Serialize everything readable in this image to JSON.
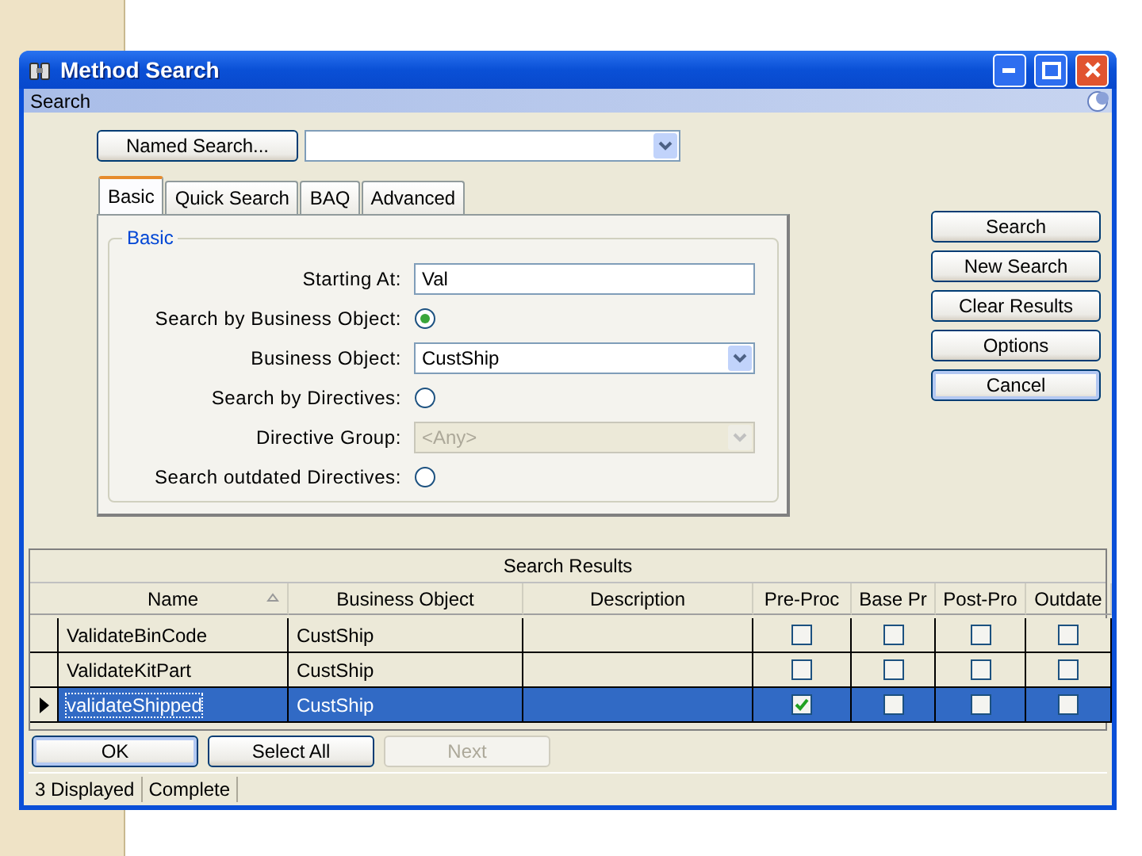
{
  "window": {
    "title": "Method Search",
    "subtitle": "Search"
  },
  "named_search": {
    "button": "Named Search..."
  },
  "tabs": [
    {
      "label": "Basic",
      "selected": true
    },
    {
      "label": "Quick Search",
      "selected": false
    },
    {
      "label": "BAQ",
      "selected": false
    },
    {
      "label": "Advanced",
      "selected": false
    }
  ],
  "group": {
    "title": "Basic",
    "fields": [
      {
        "kind": "text",
        "label": "Starting At:",
        "value": "Val",
        "disabled": false
      },
      {
        "kind": "radio",
        "label": "Search by Business Object:",
        "checked": true
      },
      {
        "kind": "select",
        "label": "Business Object:",
        "value": "CustShip",
        "disabled": false
      },
      {
        "kind": "radio",
        "label": "Search by Directives:",
        "checked": false
      },
      {
        "kind": "select",
        "label": "Directive Group:",
        "value": "<Any>",
        "disabled": true
      },
      {
        "kind": "radio",
        "label": "Search outdated Directives:",
        "checked": false
      }
    ]
  },
  "side_buttons": [
    {
      "label": "Search",
      "focused": false
    },
    {
      "label": "New Search",
      "focused": false
    },
    {
      "label": "Clear Results",
      "focused": false
    },
    {
      "label": "Options",
      "focused": false
    },
    {
      "label": "Cancel",
      "focused": true
    }
  ],
  "results": {
    "title": "Search Results",
    "columns": [
      {
        "label": "Name",
        "sorted": true
      },
      {
        "label": "Business Object",
        "sorted": false
      },
      {
        "label": "Description",
        "sorted": false
      },
      {
        "label": "Pre-Proc",
        "sorted": false
      },
      {
        "label": "Base Pr",
        "sorted": false
      },
      {
        "label": "Post-Pro",
        "sorted": false
      },
      {
        "label": "Outdate",
        "sorted": false
      }
    ],
    "rows": [
      {
        "name": "ValidateBinCode",
        "business_object": "CustShip",
        "checks": [
          false,
          false,
          false,
          false
        ],
        "selected": false
      },
      {
        "name": "ValidateKitPart",
        "business_object": "CustShip",
        "checks": [
          false,
          false,
          false,
          false
        ],
        "selected": false
      },
      {
        "name": "validateShipped",
        "business_object": "CustShip",
        "checks": [
          true,
          false,
          false,
          false
        ],
        "selected": true
      }
    ]
  },
  "bottom_buttons": [
    {
      "label": "OK",
      "disabled": false,
      "focused": true
    },
    {
      "label": "Select All",
      "disabled": false,
      "focused": false
    },
    {
      "label": "Next",
      "disabled": true,
      "focused": false
    }
  ],
  "status_bar": [
    "3 Displayed",
    "Complete"
  ]
}
